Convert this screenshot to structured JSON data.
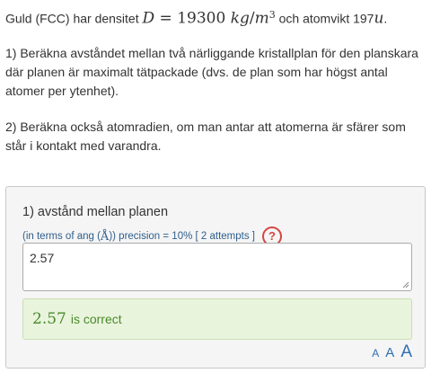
{
  "problem": {
    "intro_prefix": "Guld (FCC) har densitet ",
    "density_symbol": "D",
    "density_equals": " = 19300 ",
    "density_unit_num": "kg",
    "density_unit_den": "m",
    "density_exp": "3",
    "intro_middle": " och atomvikt 197",
    "atomic_unit": "u",
    "intro_suffix": ".",
    "q1_text": "1) Beräkna avståndet mellan två närliggande kristallplan för den planskara där planen är maximalt tätpackade (dvs. de plan som har högst antal atomer per ytenhet).",
    "q2_text": "2) Beräkna också atomradien, om man antar att atomerna är sfärer som står i kontakt med varandra."
  },
  "answer_panel": {
    "title": "1) avstånd mellan planen",
    "sub_prefix": "(in terms of ang (",
    "sub_angstrom": "Å",
    "sub_suffix": ")) precision = 10% [ 2 attempts ]",
    "help_label": "?",
    "answer_value": "2.57",
    "feedback_value": "2.57",
    "feedback_message": "is correct",
    "font_size_labels": [
      "A",
      "A",
      "A"
    ]
  },
  "colors": {
    "accent_blue": "#2f6fb0",
    "help_red": "#d64541",
    "success_green": "#4a8a2a",
    "success_bg": "#e9f4dd"
  }
}
